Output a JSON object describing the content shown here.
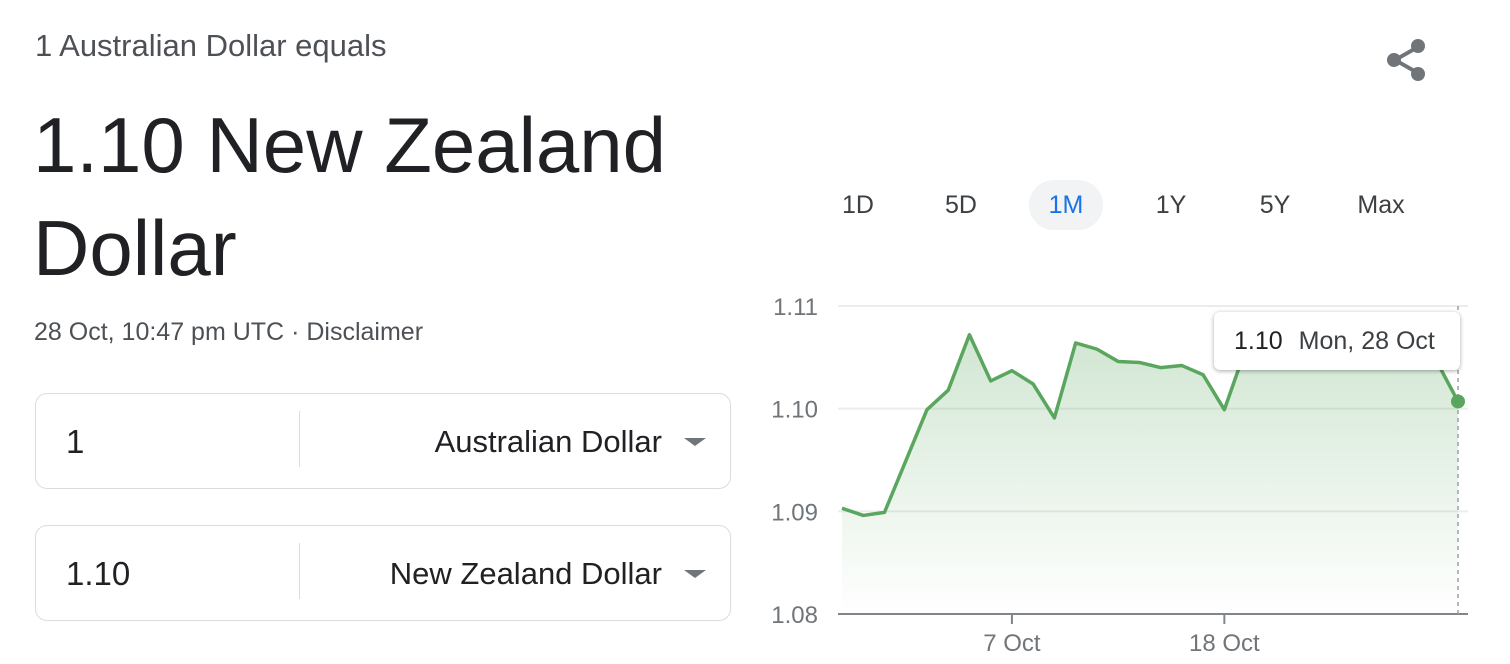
{
  "header": {
    "subtitle": "1 Australian Dollar equals",
    "headline": "1.10 New Zealand Dollar",
    "timestamp": "28 Oct, 10:47 pm UTC",
    "separator": "·",
    "disclaimer": "Disclaimer",
    "share_icon": "share-icon"
  },
  "converter": {
    "from": {
      "amount": "1",
      "currency": "Australian Dollar"
    },
    "to": {
      "amount": "1.10",
      "currency": "New Zealand Dollar"
    },
    "dropdown_icon": "triangle-down-icon"
  },
  "range_tabs": {
    "items": [
      "1D",
      "5D",
      "1M",
      "1Y",
      "5Y",
      "Max"
    ],
    "active": "1M",
    "active_color": "#1a73e8"
  },
  "tooltip": {
    "value": "1.10",
    "date": "Mon, 28 Oct"
  },
  "chart_data": {
    "type": "area",
    "y_ticks": [
      "1.11",
      "1.10",
      "1.09",
      "1.08"
    ],
    "ylim": [
      1.08,
      1.11
    ],
    "x_ticks": [
      {
        "label": "7 Oct",
        "index": 8
      },
      {
        "label": "18 Oct",
        "index": 18
      }
    ],
    "grid": true,
    "line_color": "#5aa65f",
    "series": [
      {
        "values": [
          1.0903,
          1.0896,
          1.0899,
          1.0949,
          1.0999,
          1.1018,
          1.1072,
          1.1027,
          1.1037,
          1.1024,
          1.0991,
          1.1064,
          1.1058,
          1.1046,
          1.1045,
          1.104,
          1.1042,
          1.1033,
          1.0999,
          1.1058,
          1.106,
          1.1058,
          1.1066,
          1.1056,
          1.1045,
          1.105,
          1.105,
          1.1048,
          1.1046,
          1.1007
        ]
      }
    ]
  }
}
